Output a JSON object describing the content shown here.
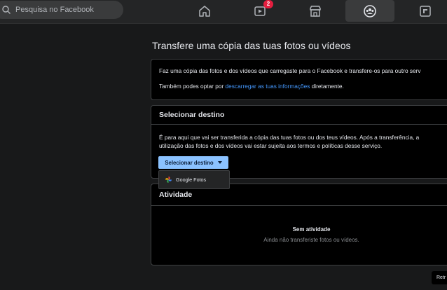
{
  "topbar": {
    "search_placeholder": "Pesquisa no Facebook",
    "tabs": [
      {
        "icon": "home-icon"
      },
      {
        "icon": "video-icon",
        "badge": "2"
      },
      {
        "icon": "marketplace-icon"
      },
      {
        "icon": "groups-icon",
        "active": true
      },
      {
        "icon": "gaming-icon"
      }
    ]
  },
  "page": {
    "title": "Transfere uma cópia das tuas fotos ou vídeos"
  },
  "intro": {
    "line1": "Faz uma cópia das fotos e dos vídeos que carregaste para o Facebook e transfere-os para outro serv",
    "line2_before": "Também podes optar por ",
    "line2_link": "descarregar as tuas informações",
    "line2_after": " diretamente."
  },
  "destination": {
    "title": "Selecionar destino",
    "desc_line1": "É para aqui que vai ser transferida a cópia das tuas fotos ou dos teus vídeos. Após a transferência, a",
    "desc_line2": "utilização das fotos e dos vídeos vai estar sujeita aos termos e políticas desse serviço.",
    "button_label": "Selecionar destino",
    "options": [
      "Google Fotos"
    ]
  },
  "activity": {
    "title": "Atividade",
    "empty_title": "Sem atividade",
    "empty_sub": "Ainda não transferiste fotos ou vídeos."
  },
  "footer": {
    "button_label": "Retr"
  },
  "colors": {
    "background": "#18191a",
    "topbar": "#242526",
    "accent_button": "#8bc2ff",
    "link": "#4599ff",
    "badge": "#e41e3f"
  }
}
